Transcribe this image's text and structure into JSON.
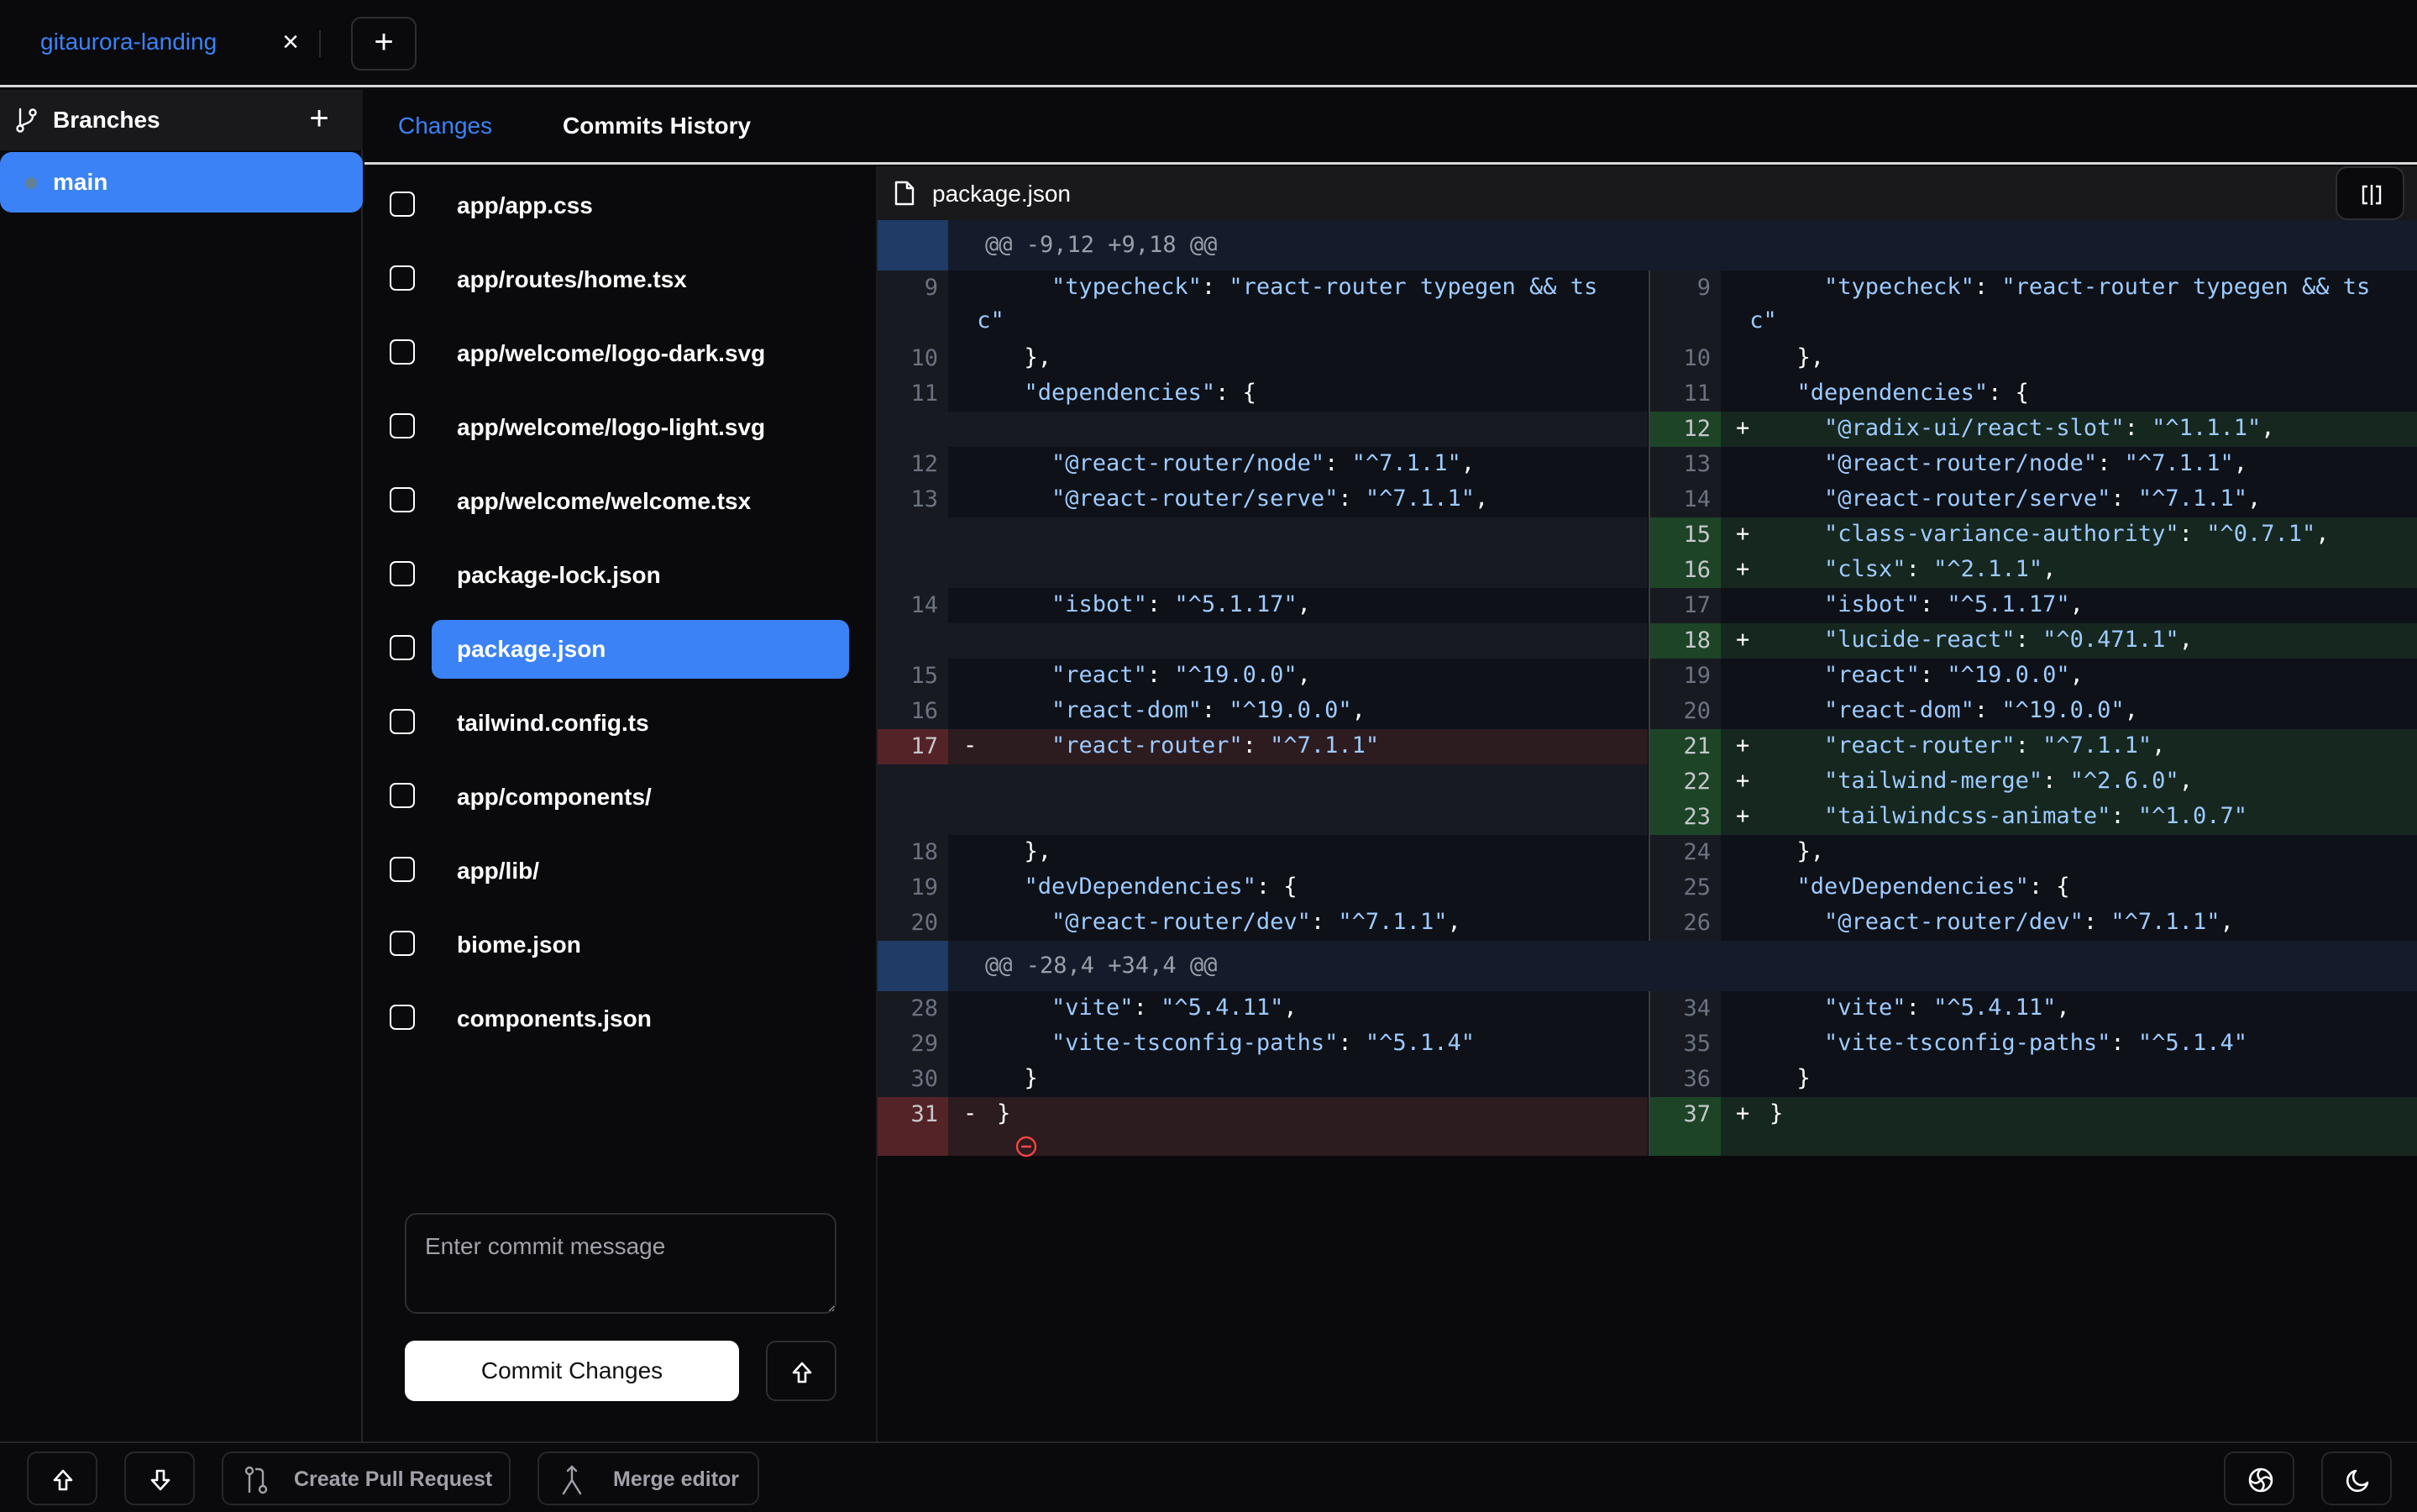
{
  "topbar": {
    "repo_tab": "gitaurora-landing",
    "close_icon": "close-icon",
    "new_tab_icon": "plus-icon"
  },
  "sidebar": {
    "title": "Branches",
    "branches": [
      {
        "name": "main",
        "active": true
      }
    ]
  },
  "tabs": [
    {
      "label": "Changes",
      "active": true
    },
    {
      "label": "Commits History",
      "active": false
    }
  ],
  "files": [
    {
      "name": "app/app.css",
      "checked": false,
      "selected": false
    },
    {
      "name": "app/routes/home.tsx",
      "checked": false,
      "selected": false
    },
    {
      "name": "app/welcome/logo-dark.svg",
      "checked": false,
      "selected": false
    },
    {
      "name": "app/welcome/logo-light.svg",
      "checked": false,
      "selected": false
    },
    {
      "name": "app/welcome/welcome.tsx",
      "checked": false,
      "selected": false
    },
    {
      "name": "package-lock.json",
      "checked": false,
      "selected": false
    },
    {
      "name": "package.json",
      "checked": false,
      "selected": true
    },
    {
      "name": "tailwind.config.ts",
      "checked": false,
      "selected": false
    },
    {
      "name": "app/components/",
      "checked": false,
      "selected": false
    },
    {
      "name": "app/lib/",
      "checked": false,
      "selected": false
    },
    {
      "name": "biome.json",
      "checked": false,
      "selected": false
    },
    {
      "name": "components.json",
      "checked": false,
      "selected": false
    }
  ],
  "commit": {
    "placeholder": "Enter commit message",
    "value": "",
    "button_label": "Commit Changes"
  },
  "diff": {
    "file": "package.json",
    "hunks": [
      {
        "header": "@@ -9,12 +9,18 @@",
        "rows": [
          {
            "l": {
              "n": "9",
              "t": "ctx",
              "k": "typecheck",
              "v": "react-router typegen && tsc",
              "indent": 4,
              "tail": ",",
              "wrap": true,
              "raw": "    \"typecheck\": \"react-router typegen && ts\nc\""
            },
            "r": {
              "n": "9",
              "t": "ctx",
              "raw": "    \"typecheck\": \"react-router typegen && ts\nc\""
            }
          },
          {
            "l": {
              "n": "10",
              "t": "ctx",
              "raw": "  },"
            },
            "r": {
              "n": "10",
              "t": "ctx",
              "raw": "  },"
            }
          },
          {
            "l": {
              "n": "11",
              "t": "ctx",
              "raw": "  \"dependencies\": {"
            },
            "r": {
              "n": "11",
              "t": "ctx",
              "raw": "  \"dependencies\": {"
            }
          },
          {
            "l": {
              "t": "filler"
            },
            "r": {
              "n": "12",
              "t": "add",
              "raw": "    \"@radix-ui/react-slot\": \"^1.1.1\","
            }
          },
          {
            "l": {
              "n": "12",
              "t": "ctx",
              "raw": "    \"@react-router/node\": \"^7.1.1\","
            },
            "r": {
              "n": "13",
              "t": "ctx",
              "raw": "    \"@react-router/node\": \"^7.1.1\","
            }
          },
          {
            "l": {
              "n": "13",
              "t": "ctx",
              "raw": "    \"@react-router/serve\": \"^7.1.1\","
            },
            "r": {
              "n": "14",
              "t": "ctx",
              "raw": "    \"@react-router/serve\": \"^7.1.1\","
            }
          },
          {
            "l": {
              "t": "filler"
            },
            "r": {
              "n": "15",
              "t": "add",
              "raw": "    \"class-variance-authority\": \"^0.7.1\","
            }
          },
          {
            "l": {
              "t": "filler"
            },
            "r": {
              "n": "16",
              "t": "add",
              "raw": "    \"clsx\": \"^2.1.1\","
            }
          },
          {
            "l": {
              "n": "14",
              "t": "ctx",
              "raw": "    \"isbot\": \"^5.1.17\","
            },
            "r": {
              "n": "17",
              "t": "ctx",
              "raw": "    \"isbot\": \"^5.1.17\","
            }
          },
          {
            "l": {
              "t": "filler"
            },
            "r": {
              "n": "18",
              "t": "add",
              "raw": "    \"lucide-react\": \"^0.471.1\","
            }
          },
          {
            "l": {
              "n": "15",
              "t": "ctx",
              "raw": "    \"react\": \"^19.0.0\","
            },
            "r": {
              "n": "19",
              "t": "ctx",
              "raw": "    \"react\": \"^19.0.0\","
            }
          },
          {
            "l": {
              "n": "16",
              "t": "ctx",
              "raw": "    \"react-dom\": \"^19.0.0\","
            },
            "r": {
              "n": "20",
              "t": "ctx",
              "raw": "    \"react-dom\": \"^19.0.0\","
            }
          },
          {
            "l": {
              "n": "17",
              "t": "del",
              "raw": "    \"react-router\": \"^7.1.1\""
            },
            "r": {
              "n": "21",
              "t": "add",
              "raw": "    \"react-router\": \"^7.1.1\","
            }
          },
          {
            "l": {
              "t": "filler"
            },
            "r": {
              "n": "22",
              "t": "add",
              "raw": "    \"tailwind-merge\": \"^2.6.0\","
            }
          },
          {
            "l": {
              "t": "filler"
            },
            "r": {
              "n": "23",
              "t": "add",
              "raw": "    \"tailwindcss-animate\": \"^1.0.7\""
            }
          },
          {
            "l": {
              "n": "18",
              "t": "ctx",
              "raw": "  },"
            },
            "r": {
              "n": "24",
              "t": "ctx",
              "raw": "  },"
            }
          },
          {
            "l": {
              "n": "19",
              "t": "ctx",
              "raw": "  \"devDependencies\": {"
            },
            "r": {
              "n": "25",
              "t": "ctx",
              "raw": "  \"devDependencies\": {"
            }
          },
          {
            "l": {
              "n": "20",
              "t": "ctx",
              "raw": "    \"@react-router/dev\": \"^7.1.1\","
            },
            "r": {
              "n": "26",
              "t": "ctx",
              "raw": "    \"@react-router/dev\": \"^7.1.1\","
            }
          }
        ]
      },
      {
        "header": "@@ -28,4 +34,4 @@",
        "rows": [
          {
            "l": {
              "n": "28",
              "t": "ctx",
              "raw": "    \"vite\": \"^5.4.11\","
            },
            "r": {
              "n": "34",
              "t": "ctx",
              "raw": "    \"vite\": \"^5.4.11\","
            }
          },
          {
            "l": {
              "n": "29",
              "t": "ctx",
              "raw": "    \"vite-tsconfig-paths\": \"^5.1.4\""
            },
            "r": {
              "n": "35",
              "t": "ctx",
              "raw": "    \"vite-tsconfig-paths\": \"^5.1.4\""
            }
          },
          {
            "l": {
              "n": "30",
              "t": "ctx",
              "raw": "  }"
            },
            "r": {
              "n": "36",
              "t": "ctx",
              "raw": "  }"
            }
          },
          {
            "l": {
              "n": "31",
              "t": "del",
              "raw": "}",
              "no_newline": true
            },
            "r": {
              "n": "37",
              "t": "add",
              "raw": "}"
            }
          }
        ]
      }
    ]
  },
  "bottombar": {
    "pull_icon": "arrow-up-icon",
    "fetch_icon": "arrow-down-icon",
    "create_pr": "Create Pull Request",
    "merge_editor": "Merge editor",
    "theme_icon": "aperture-icon",
    "dark_mode_icon": "moon-icon"
  },
  "colors": {
    "accent": "#3b82f6",
    "added_bg": "#16271f",
    "removed_bg": "#2c1b1f",
    "hunk_bg": "#141c2c",
    "string": "#9ecbff"
  }
}
